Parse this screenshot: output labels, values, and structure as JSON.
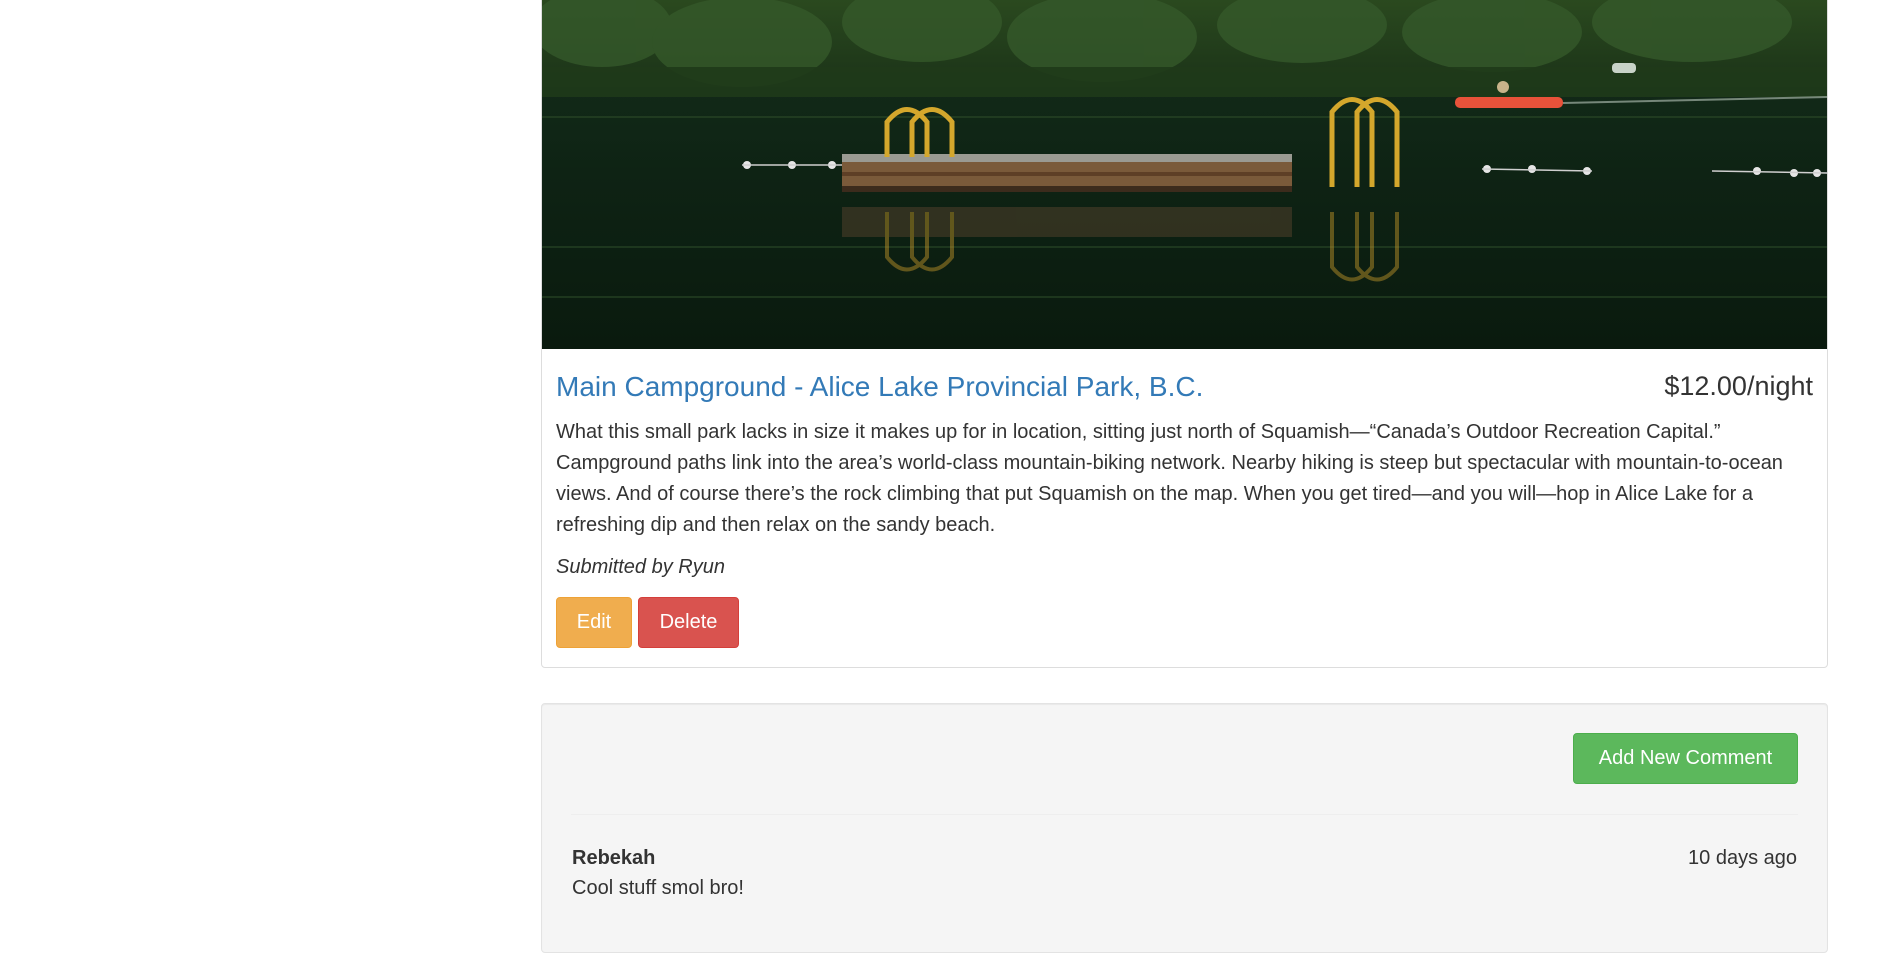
{
  "campground": {
    "name": "Main Campground - Alice Lake Provincial Park, B.C.",
    "price": "$12.00/night",
    "description": "What this small park lacks in size it makes up for in location, sitting just north of Squamish—“Canada’s Outdoor Recreation Capital.” Campground paths link into the area’s world-class mountain-biking network. Nearby hiking is steep but spectacular with mountain-to-ocean views. And of course there’s the rock climbing that put Squamish on the map. When you get tired—and you will—hop in Alice Lake for a refreshing dip and then relax on the sandy beach.",
    "submitted_by": "Submitted by Ryun",
    "edit_label": "Edit",
    "delete_label": "Delete"
  },
  "comments_section": {
    "add_label": "Add New Comment",
    "comments": [
      {
        "author": "Rebekah",
        "time": "10 days ago",
        "text": "Cool stuff smol bro!"
      }
    ]
  },
  "colors": {
    "link": "#337ab7",
    "edit_button": "#f0ad4e",
    "delete_button": "#d9534f",
    "add_button": "#5cb85c",
    "well_background": "#f5f5f5"
  }
}
